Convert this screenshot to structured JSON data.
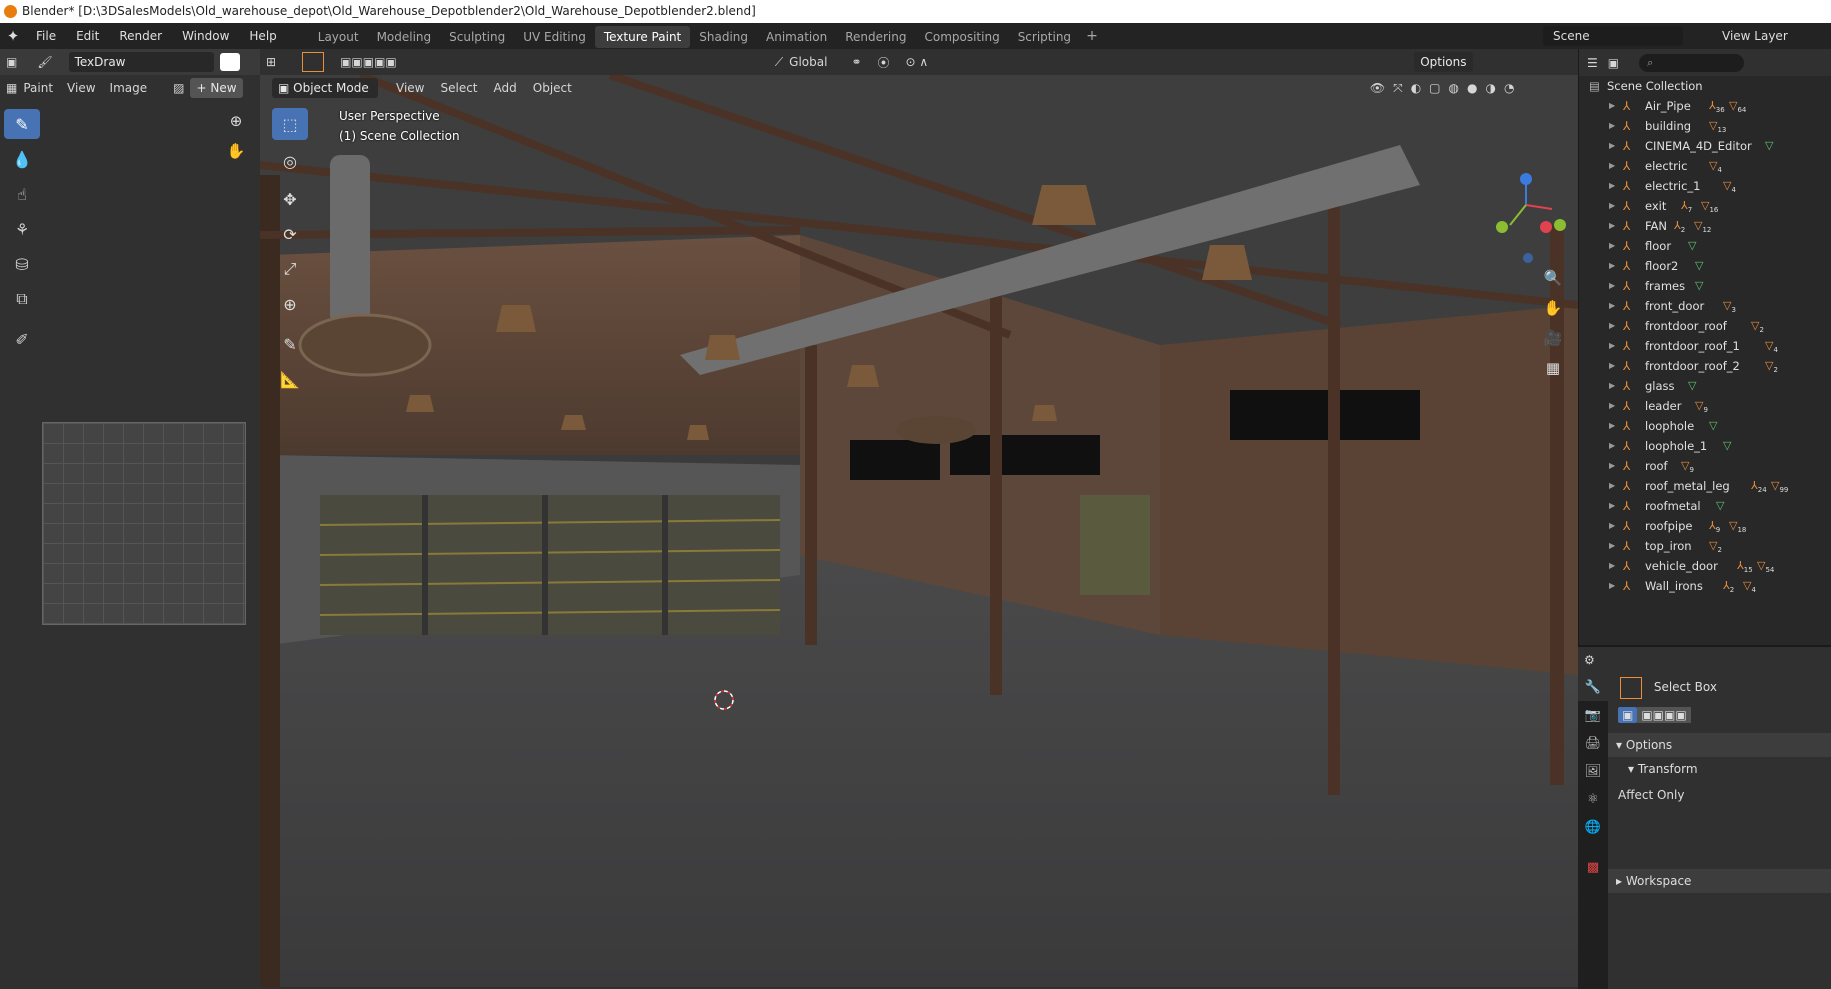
{
  "window": {
    "title": "Blender* [D:\\3DSalesModels\\Old_warehouse_depot\\Old_Warehouse_Depotblender2\\Old_Warehouse_Depotblender2.blend]"
  },
  "menu": {
    "file": "File",
    "edit": "Edit",
    "render": "Render",
    "window": "Window",
    "help": "Help"
  },
  "workspaces": [
    {
      "label": "Layout"
    },
    {
      "label": "Modeling"
    },
    {
      "label": "Sculpting"
    },
    {
      "label": "UV Editing"
    },
    {
      "label": "Texture Paint"
    },
    {
      "label": "Shading"
    },
    {
      "label": "Animation"
    },
    {
      "label": "Rendering"
    },
    {
      "label": "Compositing"
    },
    {
      "label": "Scripting"
    }
  ],
  "scene": {
    "name": "Scene",
    "view_layer": "View Layer"
  },
  "image_editor": {
    "brush": "TexDraw",
    "mode": "Paint",
    "view": "View",
    "image": "Image",
    "new": "New"
  },
  "viewport": {
    "mode": "Object Mode",
    "view": "View",
    "select": "Select",
    "add": "Add",
    "object": "Object",
    "perspective": "User Perspective",
    "collection": "(1) Scene Collection",
    "orientation": "Global",
    "options": "Options"
  },
  "outliner": {
    "root": "Scene Collection",
    "items": [
      {
        "name": "Air_Pipe",
        "b1": "36",
        "b2": "64"
      },
      {
        "name": "building",
        "b1": "",
        "b2": "13"
      },
      {
        "name": "CINEMA_4D_Editor",
        "b1": "",
        "b2": ""
      },
      {
        "name": "electric",
        "b1": "",
        "b2": "4"
      },
      {
        "name": "electric_1",
        "b1": "",
        "b2": "4"
      },
      {
        "name": "exit",
        "b1": "7",
        "b2": "16"
      },
      {
        "name": "FAN",
        "b1": "2",
        "b2": "12"
      },
      {
        "name": "floor",
        "b1": "",
        "b2": ""
      },
      {
        "name": "floor2",
        "b1": "",
        "b2": ""
      },
      {
        "name": "frames",
        "b1": "",
        "b2": ""
      },
      {
        "name": "front_door",
        "b1": "",
        "b2": "3"
      },
      {
        "name": "frontdoor_roof",
        "b1": "",
        "b2": "2"
      },
      {
        "name": "frontdoor_roof_1",
        "b1": "",
        "b2": "4"
      },
      {
        "name": "frontdoor_roof_2",
        "b1": "",
        "b2": "2"
      },
      {
        "name": "glass",
        "b1": "",
        "b2": ""
      },
      {
        "name": "leader",
        "b1": "",
        "b2": "9"
      },
      {
        "name": "loophole",
        "b1": "",
        "b2": ""
      },
      {
        "name": "loophole_1",
        "b1": "",
        "b2": ""
      },
      {
        "name": "roof",
        "b1": "",
        "b2": "9"
      },
      {
        "name": "roof_metal_leg",
        "b1": "24",
        "b2": "99"
      },
      {
        "name": "roofmetal",
        "b1": "",
        "b2": ""
      },
      {
        "name": "roofpipe",
        "b1": "9",
        "b2": "18"
      },
      {
        "name": "top_iron",
        "b1": "",
        "b2": "2"
      },
      {
        "name": "vehicle_door",
        "b1": "15",
        "b2": "54"
      },
      {
        "name": "Wall_irons",
        "b1": "2",
        "b2": "4"
      }
    ]
  },
  "properties": {
    "tool": "Select Box",
    "options": "Options",
    "transform": "Transform",
    "affect_only": "Affect Only",
    "workspace": "Workspace"
  }
}
